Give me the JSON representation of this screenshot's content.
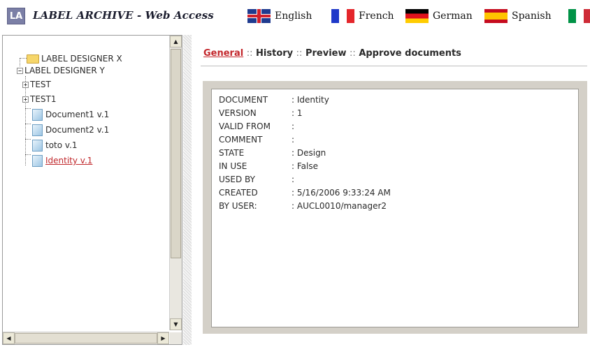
{
  "header": {
    "logo": "LA",
    "title": "LABEL ARCHIVE - Web Access",
    "languages": [
      {
        "label": "English",
        "flag": "uk-flag-icon"
      },
      {
        "label": "French",
        "flag": "france-flag-icon"
      },
      {
        "label": "German",
        "flag": "germany-flag-icon"
      },
      {
        "label": "Spanish",
        "flag": "spain-flag-icon"
      },
      {
        "label": "",
        "flag": "italy-flag-icon"
      }
    ]
  },
  "tree": {
    "nodes": [
      {
        "label": "LABEL DESIGNER X",
        "type": "folder"
      },
      {
        "label": "LABEL DESIGNER Y",
        "type": "expanded"
      },
      {
        "label": "TEST",
        "type": "collapsed"
      },
      {
        "label": "TEST1",
        "type": "collapsed"
      },
      {
        "label": "Document1 v.1",
        "type": "document"
      },
      {
        "label": "Document2 v.1",
        "type": "document"
      },
      {
        "label": "toto v.1",
        "type": "document"
      },
      {
        "label": "Identity v.1",
        "type": "document",
        "selected": true
      }
    ]
  },
  "tabs": {
    "general": "General",
    "history": "History",
    "preview": "Preview",
    "approve": "Approve documents",
    "separator": "::"
  },
  "details": [
    {
      "label": "DOCUMENT",
      "value": ": Identity"
    },
    {
      "label": "VERSION",
      "value": ": 1"
    },
    {
      "label": "VALID FROM",
      "value": ":"
    },
    {
      "label": "COMMENT",
      "value": ":"
    },
    {
      "label": "STATE",
      "value": ": Design"
    },
    {
      "label": "IN USE",
      "value": ": False"
    },
    {
      "label": "USED BY",
      "value": ":"
    },
    {
      "label": "CREATED",
      "value": ": 5/16/2006 9:33:24 AM"
    },
    {
      "label": "BY USER:",
      "value": ": AUCL0010/manager2"
    }
  ],
  "colors": {
    "accent_link": "#c3262b",
    "frame": "#d4d0c8"
  }
}
